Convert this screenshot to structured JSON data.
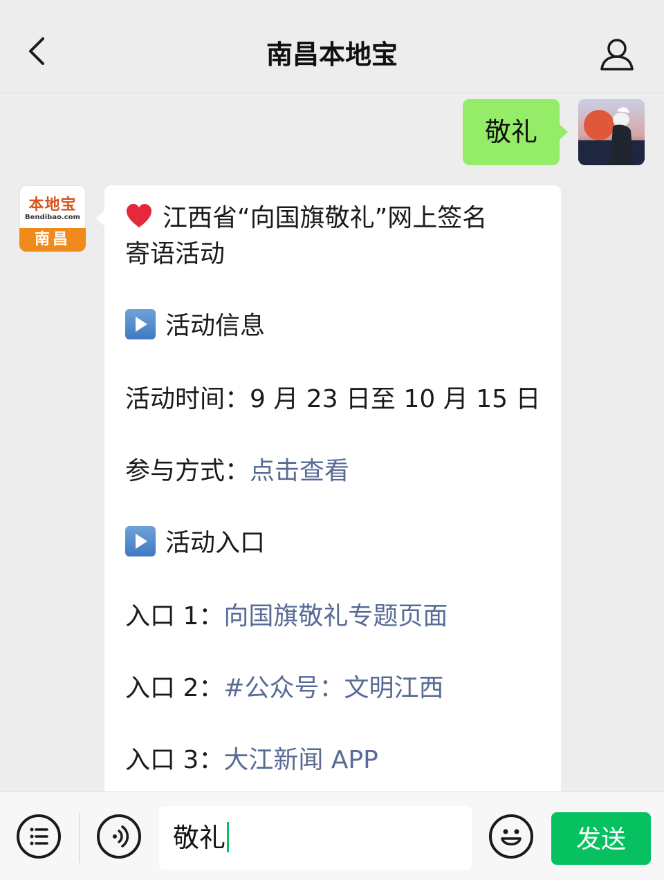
{
  "header": {
    "title": "南昌本地宝"
  },
  "sent_message": {
    "text": "敬礼"
  },
  "bot_avatar": {
    "logo_text": "本地宝",
    "logo_url": "Bendibao.com",
    "city": "南昌"
  },
  "received_message": {
    "heading": "江西省“向国旗敬礼”网上签名",
    "heading_cont": "寄语活动",
    "section_info": "活动信息",
    "time_label": "活动时间：",
    "time_value": "9 月 23 日至 10 月 15 日",
    "method_label": "参与方式：",
    "method_link": "点击查看",
    "section_entry": "活动入口",
    "entries": [
      {
        "label": "入口 1：",
        "link": "向国旗敬礼专题页面"
      },
      {
        "label": "入口 2：",
        "link": "#公众号：文明江西"
      },
      {
        "label": "入口 3：",
        "link": "大江新闻 APP"
      }
    ]
  },
  "input_bar": {
    "text": "敬礼",
    "send_label": "发送"
  },
  "colors": {
    "sent_bubble": "#95ec69",
    "link": "#576b95",
    "send_button": "#07c160"
  }
}
